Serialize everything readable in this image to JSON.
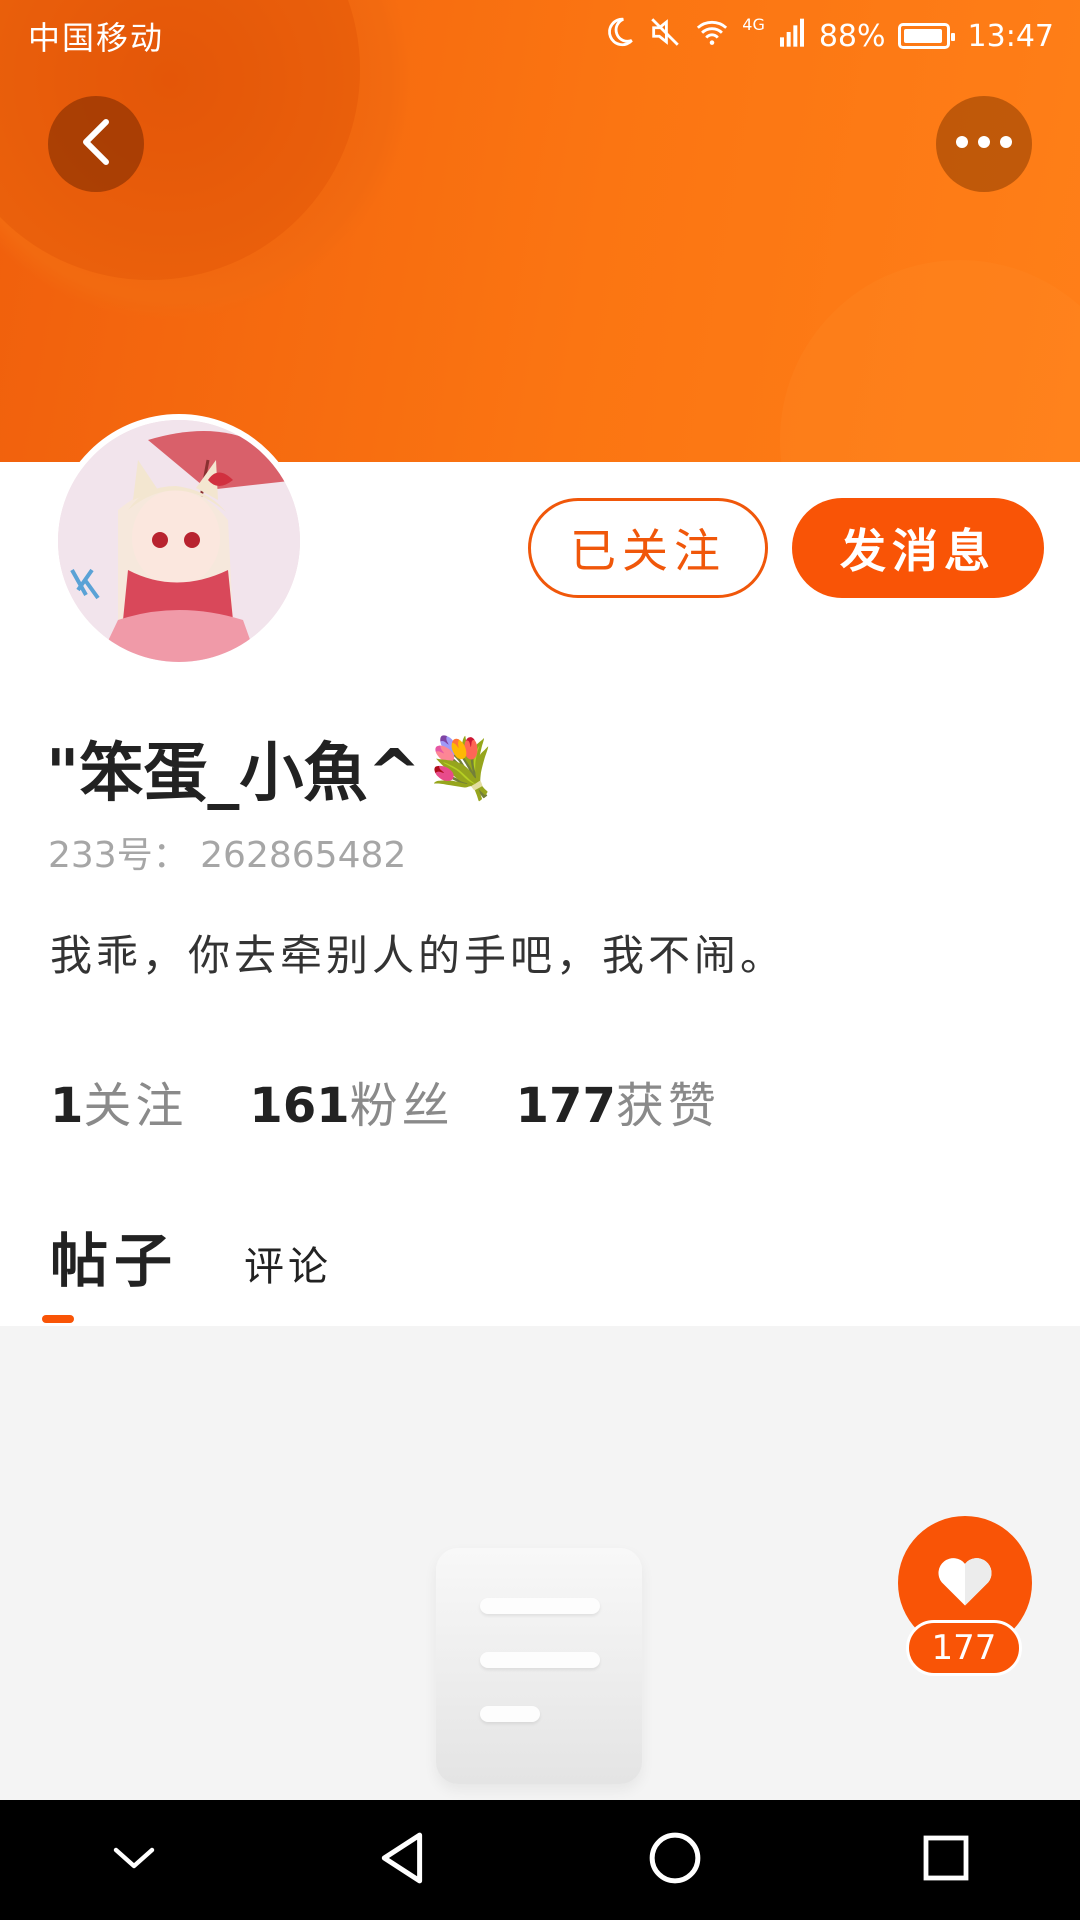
{
  "status_bar": {
    "carrier": "中国移动",
    "network": "4G",
    "battery": "88%",
    "time": "13:47",
    "icons": [
      "moon-icon",
      "mute-icon",
      "wifi-icon",
      "signal-icon",
      "battery-icon"
    ]
  },
  "header": {
    "back_icon": "chevron-left-icon",
    "more_icon": "more-dots-icon"
  },
  "profile": {
    "username": "\"笨蛋_小魚^",
    "username_emoji": "💐",
    "user_id": "233号：  262865482",
    "bio": "我乖，你去牵别人的手吧，我不闹。",
    "follow_button": "已关注",
    "message_button": "发消息"
  },
  "stats": [
    {
      "num": "1",
      "label": "关注"
    },
    {
      "num": "161",
      "label": "粉丝"
    },
    {
      "num": "177",
      "label": "获赞"
    }
  ],
  "tabs": [
    {
      "label": "帖子",
      "active": true
    },
    {
      "label": "评论",
      "active": false
    }
  ],
  "like_fab": {
    "icon": "heart-icon",
    "count": "177"
  },
  "colors": {
    "accent": "#f95406",
    "header_bg": "#fb7512",
    "content_bg": "#f4f4f4"
  },
  "nav_bar": [
    "chevron-down-icon",
    "back-triangle-icon",
    "home-circle-icon",
    "recent-square-icon"
  ]
}
